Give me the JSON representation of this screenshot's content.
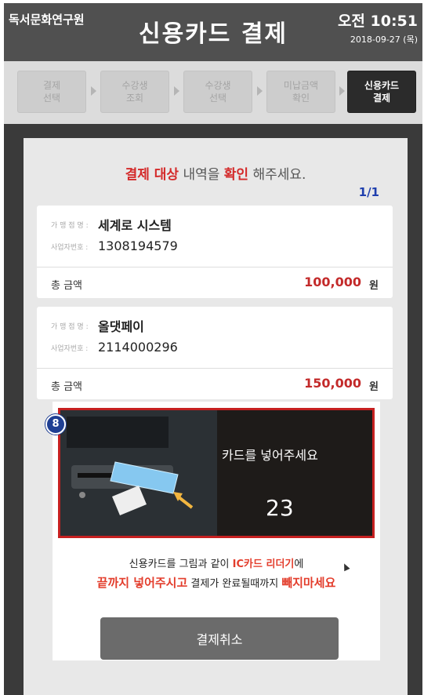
{
  "header": {
    "org_name": "독서문화연구원",
    "title": "신용카드 결제",
    "time": "오전 10:51",
    "date": "2018-09-27 (목)"
  },
  "steps": [
    {
      "label": "결제\n선택",
      "active": false
    },
    {
      "label": "수강생\n조회",
      "active": false
    },
    {
      "label": "수강생\n선택",
      "active": false
    },
    {
      "label": "미납금액\n확인",
      "active": false
    },
    {
      "label": "신용카드\n결제",
      "active": true
    }
  ],
  "panel": {
    "instruction": {
      "part1": "결제 대상",
      "part2": " 내역을 ",
      "part3": "확인",
      "part4": " 해주세요."
    },
    "pager": "1/1"
  },
  "cards": [
    {
      "merchant_label": "가 맹 점 명 :",
      "merchant_name": "세계로 시스템",
      "bizno_label": "사업자번호 :",
      "bizno": "1308194579",
      "total_label": "총 금액",
      "amount": "100,000",
      "currency": "원"
    },
    {
      "merchant_label": "가 맹 점 명 :",
      "merchant_name": "올댓페이",
      "bizno_label": "사업자번호 :",
      "bizno": "2114000296",
      "total_label": "총 금액",
      "amount": "150,000",
      "currency": "원"
    }
  ],
  "badge": "8",
  "video": {
    "message": "카드를 넣어주세요",
    "countdown": "23"
  },
  "notice": {
    "line1_a": "신용카드를 그림과 같이 ",
    "line1_b": "IC카드 리더기",
    "line1_c": "에",
    "line2_a": "끝까지 넣어주시고",
    "line2_b": " 결제가 완료될때까지 ",
    "line2_c": "빼지마세요"
  },
  "cancel_button": "결제취소",
  "colors": {
    "accent_red": "#d42a2a",
    "pager_blue": "#1f3fae",
    "badge_blue": "#1f3f93"
  }
}
